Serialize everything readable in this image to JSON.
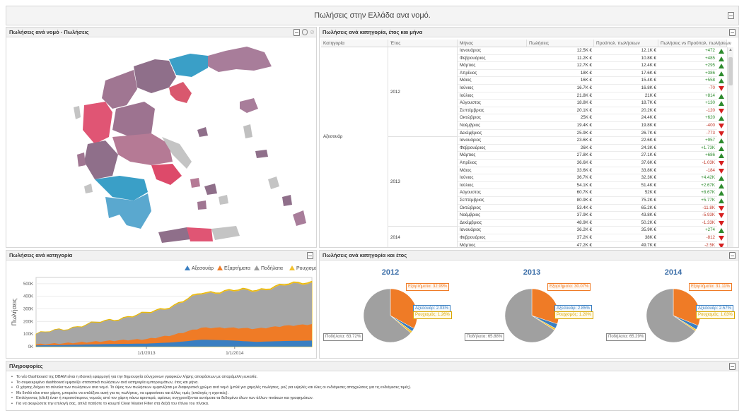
{
  "app_title": "Πωλήσεις στην Ελλάδα ανα νομό.",
  "panels": {
    "map_title": "Πωλήσεις ανά νομό - Πωλήσεις",
    "grid_title": "Πωλήσεις ανά κατηγορία, έτος και μήνα",
    "area_title": "Πωλήσεις ανά κατηγορία",
    "pie_title": "Πωλήσεις ανά κατηγορία και έτος",
    "info_title": "Πληροφορίες"
  },
  "grid": {
    "headers": [
      "Κατηγορία",
      "Έτος",
      "Μήνας",
      "Πωλήσεις",
      "Προϋπολ. πωλήσεων",
      "Πωλήσεις vs Προϋπολ. πωλήσεων"
    ],
    "category": "Αξεσουάρ",
    "years": [
      {
        "year": "2012",
        "rows": [
          {
            "m": "Ιανουάριος",
            "s": "12.5K €",
            "b": "12.1K €",
            "d": "+472",
            "up": true
          },
          {
            "m": "Φεβρουάριος",
            "s": "11.2K €",
            "b": "10.8K €",
            "d": "+485",
            "up": true
          },
          {
            "m": "Μάρτιος",
            "s": "12.7K €",
            "b": "12.4K €",
            "d": "+295",
            "up": true
          },
          {
            "m": "Απρίλιος",
            "s": "18K €",
            "b": "17.6K €",
            "d": "+386",
            "up": true
          },
          {
            "m": "Μάιος",
            "s": "16K €",
            "b": "15.4K €",
            "d": "+558",
            "up": true
          },
          {
            "m": "Ιούνιος",
            "s": "16.7K €",
            "b": "16.8K €",
            "d": "-70",
            "up": false
          },
          {
            "m": "Ιούλιος",
            "s": "21.8K €",
            "b": "21K €",
            "d": "+814",
            "up": true
          },
          {
            "m": "Αύγουστος",
            "s": "18.8K €",
            "b": "18.7K €",
            "d": "+130",
            "up": true
          },
          {
            "m": "Σεπτέμβριος",
            "s": "20.1K €",
            "b": "20.2K €",
            "d": "-120",
            "up": false
          },
          {
            "m": "Οκτώβριος",
            "s": "25K €",
            "b": "24.4K €",
            "d": "+620",
            "up": true
          },
          {
            "m": "Νοέμβριος",
            "s": "19.4K €",
            "b": "19.8K €",
            "d": "-400",
            "up": false
          },
          {
            "m": "Δεκέμβριος",
            "s": "25.9K €",
            "b": "26.7K €",
            "d": "-773",
            "up": false
          }
        ]
      },
      {
        "year": "2013",
        "rows": [
          {
            "m": "Ιανουάριος",
            "s": "23.6K €",
            "b": "22.6K €",
            "d": "+957",
            "up": true
          },
          {
            "m": "Φεβρουάριος",
            "s": "26K €",
            "b": "24.3K €",
            "d": "+1.73K",
            "up": true
          },
          {
            "m": "Μάρτιος",
            "s": "27.8K €",
            "b": "27.1K €",
            "d": "+686",
            "up": true
          },
          {
            "m": "Απρίλιος",
            "s": "36.6K €",
            "b": "37.6K €",
            "d": "-1.03K",
            "up": false
          },
          {
            "m": "Μάιος",
            "s": "33.6K €",
            "b": "33.8K €",
            "d": "-184",
            "up": false
          },
          {
            "m": "Ιούνιος",
            "s": "36.7K €",
            "b": "32.3K €",
            "d": "+4.42K",
            "up": true
          },
          {
            "m": "Ιούλιος",
            "s": "54.1K €",
            "b": "51.4K €",
            "d": "+2.67K",
            "up": true
          },
          {
            "m": "Αύγουστος",
            "s": "60.7K €",
            "b": "52K €",
            "d": "+8.67K",
            "up": true
          },
          {
            "m": "Σεπτέμβριος",
            "s": "80.9K €",
            "b": "75.2K €",
            "d": "+5.77K",
            "up": true
          },
          {
            "m": "Οκτώβριος",
            "s": "53.4K €",
            "b": "65.2K €",
            "d": "-11.8K",
            "up": false
          },
          {
            "m": "Νοέμβριος",
            "s": "37.9K €",
            "b": "43.8K €",
            "d": "-5.93K",
            "up": false
          },
          {
            "m": "Δεκέμβριος",
            "s": "48.9K €",
            "b": "50.2K €",
            "d": "-1.33K",
            "up": false
          }
        ]
      },
      {
        "year": "2014",
        "rows": [
          {
            "m": "Ιανουάριος",
            "s": "36.2K €",
            "b": "35.9K €",
            "d": "+274",
            "up": true
          },
          {
            "m": "Φεβρουάριος",
            "s": "37.2K €",
            "b": "38K €",
            "d": "-812",
            "up": false
          },
          {
            "m": "Μάρτιος",
            "s": "47.2K €",
            "b": "49.7K €",
            "d": "-2.5K",
            "up": false
          }
        ]
      }
    ]
  },
  "area_chart": {
    "ylabel": "Πωλήσεις",
    "legend": [
      {
        "name": "Αξεσουάρ",
        "color": "#3a7fc1"
      },
      {
        "name": "Εξαρτήματα",
        "color": "#ef7b26"
      },
      {
        "name": "Ποδήλατα",
        "color": "#9b9b9b"
      },
      {
        "name": "Ρουχισμός",
        "color": "#f2c12e"
      }
    ],
    "yticks": [
      "500K",
      "400K",
      "300K",
      "200K",
      "100K",
      "0K"
    ],
    "xticks": [
      "1/1/2013",
      "1/1/2014"
    ]
  },
  "chart_data": {
    "type": "area",
    "stacked": true,
    "ylabel": "Πωλήσεις",
    "ylim": [
      0,
      550000
    ],
    "x_range": [
      "2012-01",
      "2014-05"
    ],
    "x": [
      "2012-01",
      "2012-04",
      "2012-07",
      "2012-10",
      "2013-01",
      "2013-04",
      "2013-07",
      "2013-10",
      "2014-01",
      "2014-04",
      "2014-05"
    ],
    "series": [
      {
        "name": "Αξεσουάρ",
        "values": [
          10000,
          13000,
          18000,
          22000,
          24000,
          34000,
          55000,
          50000,
          38000,
          45000,
          48000
        ]
      },
      {
        "name": "Εξαρτήματα",
        "values": [
          8000,
          14000,
          20000,
          28000,
          36000,
          60000,
          95000,
          100000,
          105000,
          120000,
          130000
        ]
      },
      {
        "name": "Ποδήλατα",
        "values": [
          80000,
          110000,
          140000,
          170000,
          200000,
          230000,
          270000,
          290000,
          300000,
          320000,
          330000
        ]
      },
      {
        "name": "Ρουχισμός",
        "values": [
          2000,
          3000,
          4000,
          5000,
          6000,
          7000,
          8000,
          8000,
          9000,
          9000,
          10000
        ]
      }
    ],
    "pies": [
      {
        "year": "2012",
        "slices": [
          {
            "name": "Εξαρτήματα",
            "label": "Εξαρτήματα: 32.99%",
            "value": 32.99,
            "color": "#ef7b26"
          },
          {
            "name": "Αξεσουάρ",
            "label": "Αξεσουάρ: 2.03%",
            "value": 2.03,
            "color": "#3a7fc1"
          },
          {
            "name": "Ρουχισμός",
            "label": "Ρουχισμός: 1.26%",
            "value": 1.26,
            "color": "#f2c12e"
          },
          {
            "name": "Ποδήλατα",
            "label": "Ποδήλατα: 63.72%",
            "value": 63.72,
            "color": "#a0a0a0"
          }
        ]
      },
      {
        "year": "2013",
        "slices": [
          {
            "name": "Εξαρτήματα",
            "label": "Εξαρτήματα: 30.07%",
            "value": 30.07,
            "color": "#ef7b26"
          },
          {
            "name": "Αξεσουάρ",
            "label": "Αξεσουάρ: 2.85%",
            "value": 2.85,
            "color": "#3a7fc1"
          },
          {
            "name": "Ρουχισμός",
            "label": "Ρουχισμός: 1.20%",
            "value": 1.2,
            "color": "#f2c12e"
          },
          {
            "name": "Ποδήλατα",
            "label": "Ποδήλατα: 65.88%",
            "value": 65.88,
            "color": "#a0a0a0"
          }
        ]
      },
      {
        "year": "2014",
        "slices": [
          {
            "name": "Εξαρτήματα",
            "label": "Εξαρτήματα: 31.11%",
            "value": 31.11,
            "color": "#ef7b26"
          },
          {
            "name": "Αξεσουάρ",
            "label": "Αξεσουάρ: 2.57%",
            "value": 2.57,
            "color": "#3a7fc1"
          },
          {
            "name": "Ρουχισμός",
            "label": "Ρουχισμός: 1.03%",
            "value": 1.03,
            "color": "#f2c12e"
          },
          {
            "name": "Ποδήλατα",
            "label": "Ποδήλατα: 65.29%",
            "value": 65.29,
            "color": "#a0a0a0"
          }
        ]
      }
    ]
  },
  "info_lines": [
    "Το νέο Dashboard της DBAM είναι η ιδανική εφαρμογή για την δημιουργία σύνχρονων γραφικών λήψης αποφάσεων με απαράμιλλη ευκολία.",
    "Το συγκεκριμένο dashboard εμφανίζει στατιστικά πωλήσεων ανά κατηγορία εμπορευμάτων, έτος και μήνα.",
    "Ο χάρτης δείχνει τα σύνολα των πωλήσεων ανα νομό. Το ύψος των πωλήσεων εμφανίζεται με διαφορετικό χρώμα ανά νομό (μπλέ για χαμηλές πωλήσεις, ροζ για υψηλές και όλες οι ενδιάμεσες αποχρώσεις για τις ενδιάμεσες τιμές).",
    "Με διπλό κλικ στον χάρτη, μπορείτε να επιλέξετε αυτή για τις πωλήσεις, να εμφανίσετε και άλλες τιμές (επιλογές η σχετικές).",
    "Επιλέγοντας (click) έναν ή περισσότερους νομούς από τον χάρτη πάνω αριστερά, αμέσως συγχρονίζονται αυτόματα τα δεδομένα όλων των άλλων πινάκων και γραφημάτων.",
    "Για να ακυρώσετε την επιλογή σας, απλά πατήστε το κουμπί Clear Master Filter στα δεξιά του τίτλου του πίνακα."
  ]
}
